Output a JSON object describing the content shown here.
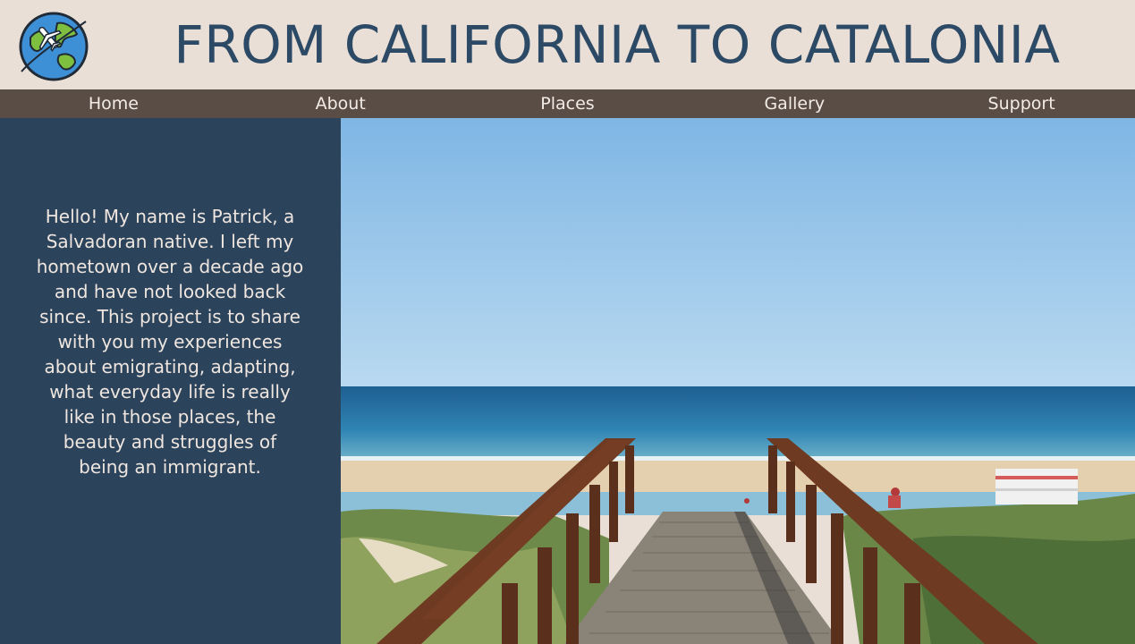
{
  "site": {
    "title": "FROM CALIFORNIA TO CATALONIA",
    "logo_icon": "globe-airplane-icon"
  },
  "nav": {
    "items": [
      {
        "label": "Home"
      },
      {
        "label": "About"
      },
      {
        "label": "Places"
      },
      {
        "label": "Gallery"
      },
      {
        "label": "Support"
      }
    ]
  },
  "intro": {
    "text": "Hello! My name is Patrick, a Salvadoran native. I left my hometown over a decade ago and have not looked back since. This project is to share with you my experiences about emigrating, adapting, what everyday life is really like in those places, the beauty and struggles of being an immigrant."
  },
  "hero": {
    "subject": "wooden-boardwalk-to-beach-photo"
  },
  "colors": {
    "header_bg": "#e9dfd6",
    "title": "#2c4a66",
    "nav_bg": "#5a4d46",
    "nav_text": "#f3ece6",
    "panel_bg": "#2c435c",
    "panel_text": "#eee6df"
  }
}
